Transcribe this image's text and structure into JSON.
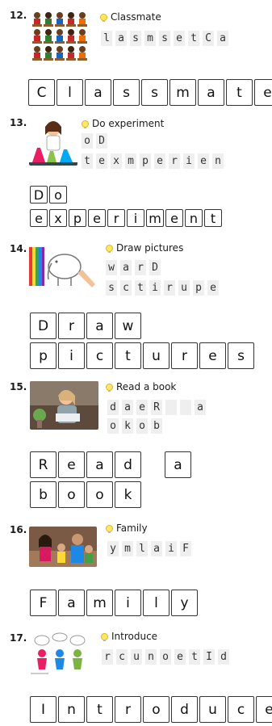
{
  "items": [
    {
      "number": "12.",
      "title": "Classmate",
      "scrambled": [
        [
          "l",
          "a",
          "s",
          "m",
          "s",
          "e",
          "t",
          "C",
          "a"
        ]
      ],
      "answer": [
        [
          "C",
          "l",
          "a",
          "s",
          "s",
          "m",
          "a",
          "t",
          "e"
        ]
      ],
      "picture_icon": "classroom-students-icon"
    },
    {
      "number": "13.",
      "title": "Do experiment",
      "scrambled": [
        [
          "o",
          "D"
        ],
        [
          "t",
          "e",
          "x",
          "m",
          "p",
          "e",
          "r",
          "i",
          "e",
          "n"
        ]
      ],
      "answer": [
        [
          "D",
          "o"
        ],
        [
          "e",
          "x",
          "p",
          "e",
          "r",
          "i",
          "m",
          "e",
          "n",
          "t"
        ]
      ],
      "picture_icon": "girl-lab-flasks-icon"
    },
    {
      "number": "14.",
      "title": "Draw pictures",
      "scrambled": [
        [
          "w",
          "a",
          "r",
          "D"
        ],
        [
          "s",
          "c",
          "t",
          "i",
          "r",
          "u",
          "p",
          "e"
        ]
      ],
      "answer": [
        [
          "D",
          "r",
          "a",
          "w"
        ],
        [
          "p",
          "i",
          "c",
          "t",
          "u",
          "r",
          "e",
          "s"
        ]
      ],
      "picture_icon": "drawing-elephant-icon"
    },
    {
      "number": "15.",
      "title": "Read a book",
      "scrambled": [
        [
          "d",
          "a",
          "e",
          "R",
          "",
          "",
          "a"
        ],
        [
          "o",
          "k",
          "o",
          "b"
        ]
      ],
      "answer": [
        [
          "R",
          "e",
          "a",
          "d",
          "",
          "a"
        ],
        [
          "b",
          "o",
          "o",
          "k"
        ]
      ],
      "picture_icon": "woman-reading-icon"
    },
    {
      "number": "16.",
      "title": "Family",
      "scrambled": [
        [
          "y",
          "m",
          "l",
          "a",
          "i",
          "F"
        ]
      ],
      "answer": [
        [
          "F",
          "a",
          "m",
          "i",
          "l",
          "y"
        ]
      ],
      "picture_icon": "family-photo-icon"
    },
    {
      "number": "17.",
      "title": "Introduce",
      "scrambled": [
        [
          "r",
          "c",
          "u",
          "n",
          "o",
          "e",
          "t",
          "I",
          "d"
        ]
      ],
      "answer": [
        [
          "I",
          "n",
          "t",
          "r",
          "o",
          "d",
          "u",
          "c",
          "e"
        ]
      ],
      "picture_icon": "people-talking-icon"
    }
  ]
}
